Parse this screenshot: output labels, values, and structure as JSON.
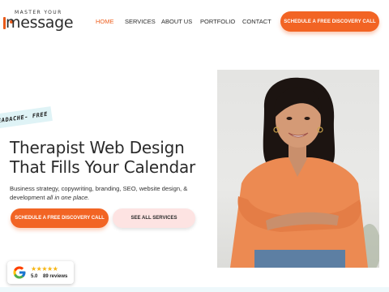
{
  "logo": {
    "top_text": "MASTER YOUR",
    "main_text": "message",
    "accent_color": "#e85a1a"
  },
  "nav": {
    "items": [
      {
        "label": "HOME",
        "active": true
      },
      {
        "label": "SERVICES",
        "active": false
      },
      {
        "label": "ABOUT US",
        "active": false
      },
      {
        "label": "PORTFOLIO",
        "active": false
      },
      {
        "label": "CONTACT",
        "active": false
      }
    ],
    "cta_label": "SCHEDULE A FREE DISCOVERY CALL"
  },
  "hero": {
    "tag": "EADACHE- FREE",
    "headline_line1": "Therapist Web Design",
    "headline_line2": "That Fills Your Calendar",
    "sub_text": "Business strategy, copywriting, branding, SEO, website design, &",
    "sub_text_2": "development",
    "sub_text_em": "all in one place.",
    "primary_button": "SCHEDULE A FREE DISCOVERY CALL",
    "secondary_button": "SEE ALL SERVICES"
  },
  "reviews": {
    "stars": "★★★★★",
    "rating": "5.0",
    "count": "89 reviews"
  },
  "colors": {
    "accent": "#f26424",
    "secondary_button_bg": "#fde3e2",
    "tag_bg": "#dff3f6",
    "star": "#f6b512"
  },
  "icons": {
    "review_platform": "google-g-icon"
  }
}
